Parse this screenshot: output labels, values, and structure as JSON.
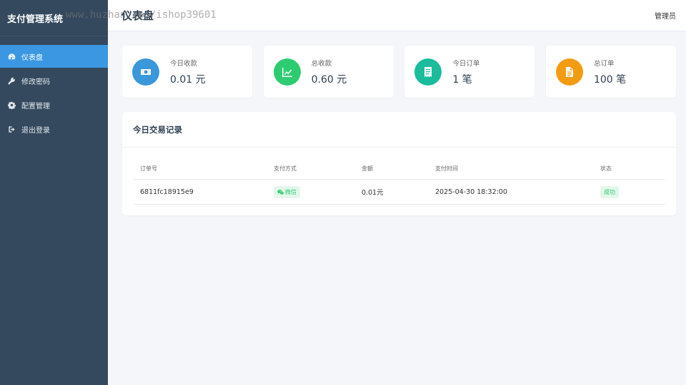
{
  "sidebar": {
    "brand": "支付管理系统",
    "items": [
      {
        "label": "仪表盘",
        "icon": "dashboard-icon",
        "active": true
      },
      {
        "label": "修改密码",
        "icon": "key-icon",
        "active": false
      },
      {
        "label": "配置管理",
        "icon": "gear-icon",
        "active": false
      },
      {
        "label": "退出登录",
        "icon": "sign-out-icon",
        "active": false
      }
    ]
  },
  "watermark": "www.huzhan.com/ishop39601",
  "header": {
    "title": "仪表盘",
    "user": "管理员"
  },
  "stats": [
    {
      "label": "今日收款",
      "value": "0.01 元",
      "icon": "money-icon",
      "color": "#3a97db"
    },
    {
      "label": "总收款",
      "value": "0.60 元",
      "icon": "line-chart-icon",
      "color": "#2ecc71"
    },
    {
      "label": "今日订单",
      "value": "1 笔",
      "icon": "receipt-icon",
      "color": "#1abc9c"
    },
    {
      "label": "总订单",
      "value": "100 笔",
      "icon": "document-icon",
      "color": "#f39c12"
    }
  ],
  "transactions": {
    "title": "今日交易记录",
    "columns": [
      "订单号",
      "支付方式",
      "金额",
      "支付时间",
      "状态"
    ],
    "rows": [
      {
        "order_no": "6811fc18915e9",
        "method": "微信",
        "amount": "0.01元",
        "time": "2025-04-30 18:32:00",
        "status": "成功"
      }
    ]
  }
}
